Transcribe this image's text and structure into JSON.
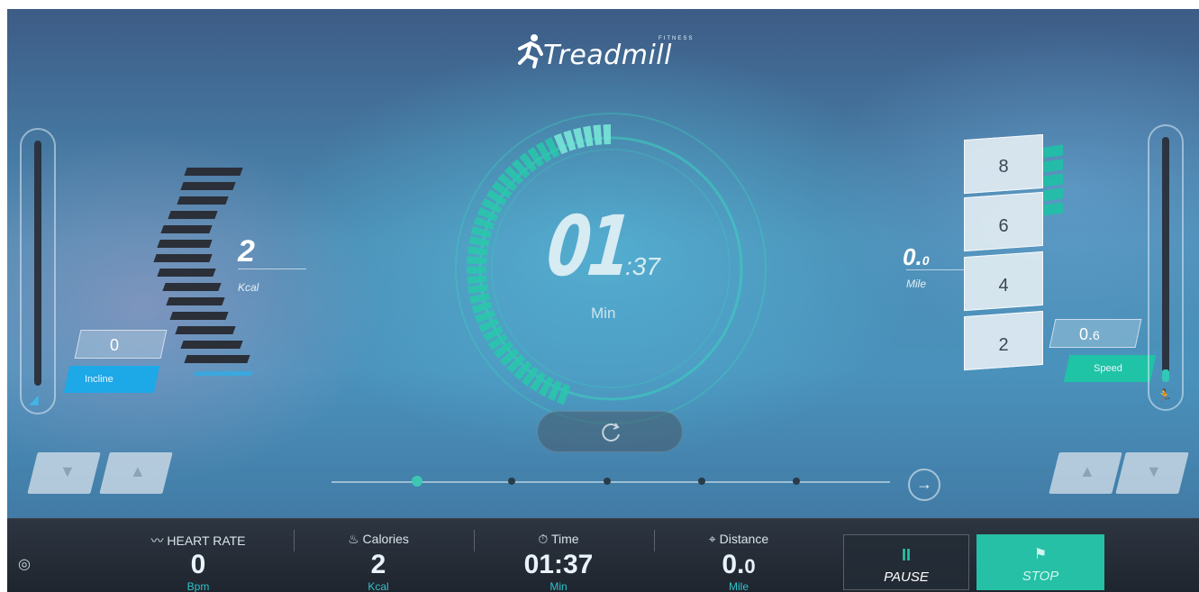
{
  "app": {
    "logo_text": "readmill",
    "logo_letter": "T",
    "logo_sub": "FITNESS"
  },
  "colors": {
    "accent_green": "#25c0a6",
    "accent_blue": "#1da8e8",
    "bar_dark": "#1f252e"
  },
  "left_panel": {
    "kcal_value": "2",
    "kcal_unit": "Kcal",
    "incline_value": "0",
    "incline_label": "Incline",
    "incline_level": 0,
    "incline_icon": "incline-icon",
    "down_icon": "arrow-down-icon",
    "up_icon": "arrow-up-icon"
  },
  "dial": {
    "minutes": "01",
    "seconds": ":37",
    "unit": "Min",
    "progress": 0.45
  },
  "refresh": {
    "icon": "refresh-icon"
  },
  "pager": {
    "page_count": 5,
    "active_index": 0,
    "next_icon": "arrow-right-circle-icon"
  },
  "right_panel": {
    "mile_value": "0.",
    "mile_decimal": "0",
    "mile_unit": "Mile",
    "speed_levels": [
      "8",
      "6",
      "4",
      "2"
    ],
    "speed_value_int": "0.",
    "speed_value_dec": "6",
    "speed_label": "Speed",
    "speed_level": 0.05,
    "speed_icon": "runner-icon"
  },
  "bottom_bar": {
    "heart_rate": {
      "label": "HEART RATE",
      "value": "0",
      "unit": "Bpm",
      "icon": "heartbeat-icon"
    },
    "calories": {
      "label": "Calories",
      "value": "2",
      "unit": "Kcal",
      "icon": "flame-icon"
    },
    "time": {
      "label": "Time",
      "value": "01:37",
      "unit": "Min",
      "icon": "stopwatch-icon"
    },
    "distance": {
      "label": "Distance",
      "value_int": "0.",
      "value_dec": "0",
      "unit": "Mile",
      "icon": "location-icon"
    },
    "pause_label": "PAUSE",
    "stop_label": "STOP",
    "left_icon": "music-icon"
  }
}
